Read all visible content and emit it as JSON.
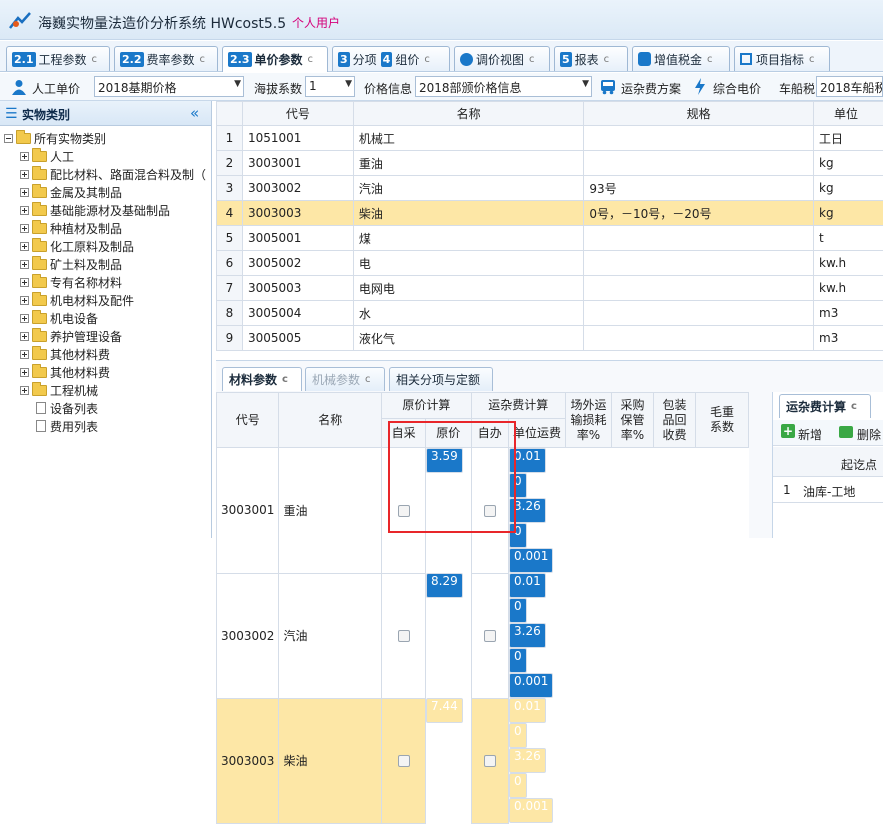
{
  "app": {
    "title": "海巍实物量法造价分析系统 HWcost5.5",
    "user_tag": "个人用户"
  },
  "tabs": [
    {
      "num": "2.1",
      "label": "工程参数"
    },
    {
      "num": "2.2",
      "label": "费率参数"
    },
    {
      "num": "2.3",
      "label": "单价参数"
    },
    {
      "num": "3",
      "label": "分项"
    },
    {
      "num": "4",
      "label": "组价"
    },
    {
      "label": "调价视图"
    },
    {
      "num": "5",
      "label": "报表"
    },
    {
      "label": "增值税金"
    },
    {
      "label": "项目指标"
    }
  ],
  "toolbar": {
    "labor_label": "人工单价",
    "labor_value": "2018基期价格",
    "altitude_label": "海拔系数",
    "altitude_value": "1",
    "price_info_label": "价格信息",
    "price_info_value": "2018部颁价格信息",
    "freight_btn": "运杂费方案",
    "power_btn": "综合电价",
    "vehicle_tax_label": "车船税",
    "vehicle_tax_value": "2018车船税"
  },
  "left": {
    "title": "实物类别",
    "root": "所有实物类别",
    "items": [
      "人工",
      "配比材料、路面混合料及制（",
      "金属及其制品",
      "基础能源材及基础制品",
      "种植材及制品",
      "化工原料及制品",
      "矿土料及制品",
      "专有名称材料",
      "机电材料及配件",
      "机电设备",
      "养护管理设备",
      "其他材料费",
      "其他材料费",
      "工程机械"
    ],
    "docs": [
      "设备列表",
      "费用列表"
    ]
  },
  "top_grid": {
    "headers": [
      "代号",
      "名称",
      "规格",
      "单位"
    ],
    "rows": [
      {
        "n": "1",
        "code": "1051001",
        "name": "机械工",
        "spec": "",
        "unit": "工日"
      },
      {
        "n": "2",
        "code": "3003001",
        "name": "重油",
        "spec": "",
        "unit": "kg"
      },
      {
        "n": "3",
        "code": "3003002",
        "name": "汽油",
        "spec": "93号",
        "unit": "kg"
      },
      {
        "n": "4",
        "code": "3003003",
        "name": "柴油",
        "spec": "0号，－10号，－20号",
        "unit": "kg"
      },
      {
        "n": "5",
        "code": "3005001",
        "name": "煤",
        "spec": "",
        "unit": "t"
      },
      {
        "n": "6",
        "code": "3005002",
        "name": "电",
        "spec": "",
        "unit": "kw.h"
      },
      {
        "n": "7",
        "code": "3005003",
        "name": "电网电",
        "spec": "",
        "unit": "kw.h"
      },
      {
        "n": "8",
        "code": "3005004",
        "name": "水",
        "spec": "",
        "unit": "m3"
      },
      {
        "n": "9",
        "code": "3005005",
        "name": "液化气",
        "spec": "",
        "unit": "m3"
      }
    ]
  },
  "bottom_tabs": [
    "材料参数",
    "机械参数",
    "相关分项与定额"
  ],
  "bottom_grid": {
    "h_code": "代号",
    "h_name": "名称",
    "h_orig": "原价计算",
    "h_freight": "运杂费计算",
    "h_self": "自采",
    "h_price": "原价",
    "h_own": "自办",
    "h_unit_freight": "单位运费",
    "h_loss": "场外运输损耗率%",
    "h_loss_lines": [
      "场外运",
      "输损耗",
      "率%"
    ],
    "h_purchase_lines": [
      "采购",
      "保管",
      "率%"
    ],
    "h_pack_lines": [
      "包装",
      "品回",
      "收费"
    ],
    "h_weight_lines": [
      "毛重",
      "系数"
    ],
    "rows": [
      {
        "code": "3003001",
        "name": "重油",
        "price": "3.59",
        "freight": "0.01",
        "loss": "0",
        "purchase": "3.26",
        "pack": "0",
        "weight": "0.001"
      },
      {
        "code": "3003002",
        "name": "汽油",
        "price": "8.29",
        "freight": "0.01",
        "loss": "0",
        "purchase": "3.26",
        "pack": "0",
        "weight": "0.001"
      },
      {
        "code": "3003003",
        "name": "柴油",
        "price": "7.44",
        "freight": "0.01",
        "loss": "0",
        "purchase": "3.26",
        "pack": "0",
        "weight": "0.001"
      }
    ]
  },
  "right_panel": {
    "tab": "运杂费计算",
    "add": "新增",
    "delete": "删除",
    "col": "起讫点",
    "row_n": "1",
    "row_val": "油库-工地"
  },
  "colors": {
    "highlight": "#fde7a6",
    "accent": "#1a78c9",
    "redbox": "#e8262a"
  }
}
